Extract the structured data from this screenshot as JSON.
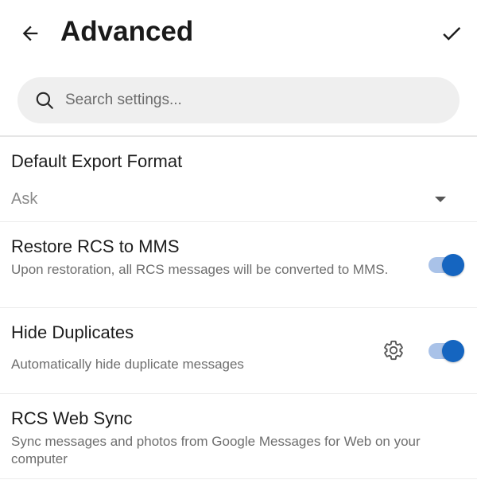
{
  "header": {
    "title": "Advanced",
    "back_icon": "arrow-back-icon",
    "confirm_icon": "check-icon"
  },
  "search": {
    "placeholder": "Search settings..."
  },
  "settings": {
    "export_format": {
      "title": "Default Export Format",
      "value": "Ask"
    },
    "restore_rcs": {
      "title": "Restore RCS to MMS",
      "description": "Upon restoration, all RCS messages will be converted to MMS.",
      "enabled": true
    },
    "hide_duplicates": {
      "title": "Hide Duplicates",
      "description": "Automatically hide duplicate messages",
      "enabled": true,
      "settings_icon": "gear-icon"
    },
    "rcs_web_sync": {
      "title": "RCS Web Sync",
      "description": "Sync messages and photos from Google Messages for Web on your computer"
    }
  },
  "colors": {
    "accent": "#1565c0",
    "toggle_track": "#a9c2e8",
    "search_bg": "#efefef"
  }
}
